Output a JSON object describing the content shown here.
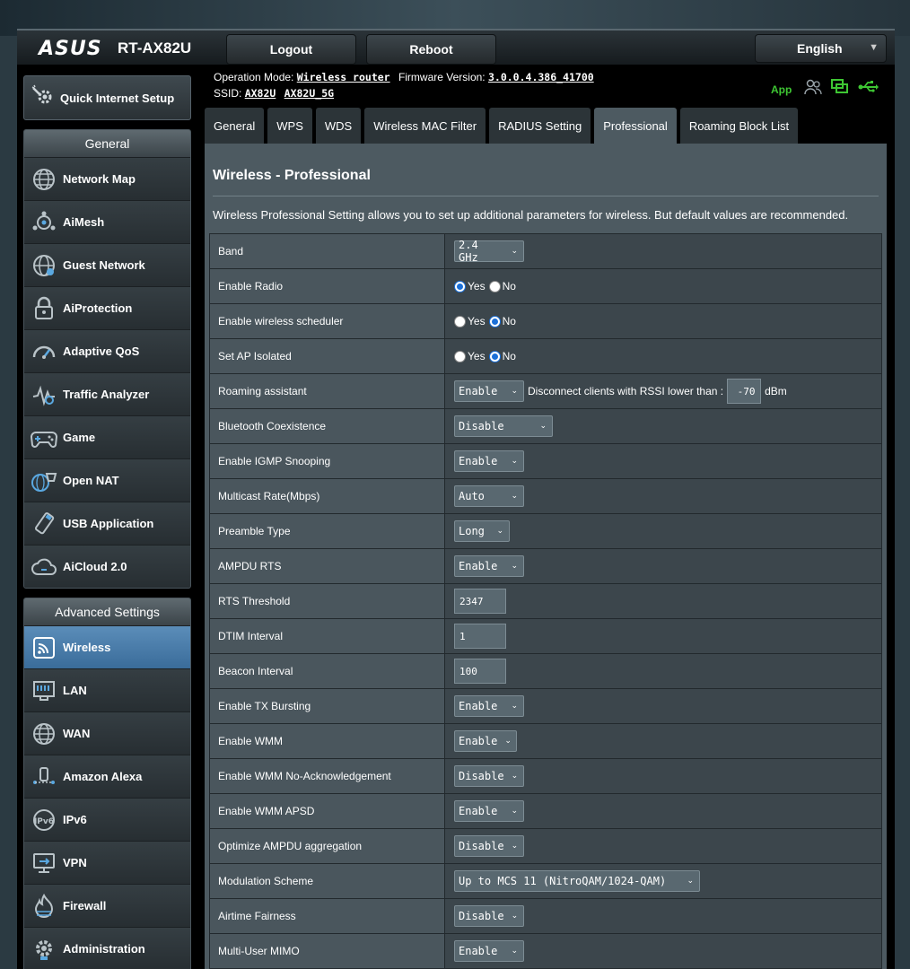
{
  "header": {
    "brand": "ASUS",
    "model": "RT-AX82U",
    "logout_label": "Logout",
    "reboot_label": "Reboot",
    "language": "English"
  },
  "info": {
    "op_mode_label": "Operation Mode:",
    "op_mode_value": "Wireless router",
    "firmware_label": "Firmware Version:",
    "firmware_value": "3.0.0.4.386_41700",
    "ssid_label": "SSID:",
    "ssid_1": "AX82U",
    "ssid_2": "AX82U_5G",
    "app_label": "App"
  },
  "sidebar": {
    "quick_setup": "Quick Internet Setup",
    "general_header": "General",
    "general_items": [
      {
        "label": "Network Map",
        "icon": "globe-icon"
      },
      {
        "label": "AiMesh",
        "icon": "aimesh-icon"
      },
      {
        "label": "Guest Network",
        "icon": "guest-globe-icon"
      },
      {
        "label": "AiProtection",
        "icon": "lock-icon"
      },
      {
        "label": "Adaptive QoS",
        "icon": "gauge-icon"
      },
      {
        "label": "Traffic Analyzer",
        "icon": "traffic-icon"
      },
      {
        "label": "Game",
        "icon": "gamepad-icon"
      },
      {
        "label": "Open NAT",
        "icon": "open-nat-icon"
      },
      {
        "label": "USB Application",
        "icon": "usb-icon"
      },
      {
        "label": "AiCloud 2.0",
        "icon": "cloud-icon"
      }
    ],
    "advanced_header": "Advanced Settings",
    "advanced_items": [
      {
        "label": "Wireless",
        "icon": "wireless-icon",
        "active": true
      },
      {
        "label": "LAN",
        "icon": "lan-icon"
      },
      {
        "label": "WAN",
        "icon": "wan-globe-icon"
      },
      {
        "label": "Amazon Alexa",
        "icon": "alexa-icon"
      },
      {
        "label": "IPv6",
        "icon": "ipv6-icon"
      },
      {
        "label": "VPN",
        "icon": "vpn-icon"
      },
      {
        "label": "Firewall",
        "icon": "firewall-icon"
      },
      {
        "label": "Administration",
        "icon": "gear-icon"
      }
    ]
  },
  "tabs": [
    "General",
    "WPS",
    "WDS",
    "Wireless MAC Filter",
    "RADIUS Setting",
    "Professional",
    "Roaming Block List"
  ],
  "active_tab": "Professional",
  "content": {
    "title": "Wireless - Professional",
    "description": "Wireless Professional Setting allows you to set up additional parameters for wireless. But default values are recommended.",
    "radio_yes": "Yes",
    "radio_no": "No",
    "roaming_text": "Disconnect clients with RSSI lower than :",
    "roaming_rssi": "-70",
    "roaming_unit": "dBm",
    "rows": [
      {
        "label": "Band",
        "type": "select",
        "value": "2.4 GHz"
      },
      {
        "label": "Enable Radio",
        "type": "radio",
        "value": "Yes"
      },
      {
        "label": "Enable wireless scheduler",
        "type": "radio",
        "value": "No"
      },
      {
        "label": "Set AP Isolated",
        "type": "radio",
        "value": "No"
      },
      {
        "label": "Roaming assistant",
        "type": "roaming",
        "value": "Enable"
      },
      {
        "label": "Bluetooth Coexistence",
        "type": "select",
        "value": "Disable"
      },
      {
        "label": "Enable IGMP Snooping",
        "type": "select",
        "value": "Enable"
      },
      {
        "label": "Multicast Rate(Mbps)",
        "type": "select",
        "value": "Auto"
      },
      {
        "label": "Preamble Type",
        "type": "select",
        "value": "Long"
      },
      {
        "label": "AMPDU RTS",
        "type": "select",
        "value": "Enable"
      },
      {
        "label": "RTS Threshold",
        "type": "input",
        "value": "2347"
      },
      {
        "label": "DTIM Interval",
        "type": "input",
        "value": "1"
      },
      {
        "label": "Beacon Interval",
        "type": "input",
        "value": "100"
      },
      {
        "label": "Enable TX Bursting",
        "type": "select",
        "value": "Enable"
      },
      {
        "label": "Enable WMM",
        "type": "select",
        "value": "Enable"
      },
      {
        "label": "Enable WMM No-Acknowledgement",
        "type": "select",
        "value": "Disable"
      },
      {
        "label": "Enable WMM APSD",
        "type": "select",
        "value": "Enable"
      },
      {
        "label": "Optimize AMPDU aggregation",
        "type": "select",
        "value": "Disable"
      },
      {
        "label": "Modulation Scheme",
        "type": "select",
        "value": "Up to MCS 11 (NitroQAM/1024-QAM)"
      },
      {
        "label": "Airtime Fairness",
        "type": "select",
        "value": "Disable"
      },
      {
        "label": "Multi-User MIMO",
        "type": "select",
        "value": "Enable"
      }
    ]
  },
  "colors": {
    "accent_active": "#3a6c9a",
    "app_green": "#3ec633",
    "radio_blue": "#1a6fd8"
  }
}
